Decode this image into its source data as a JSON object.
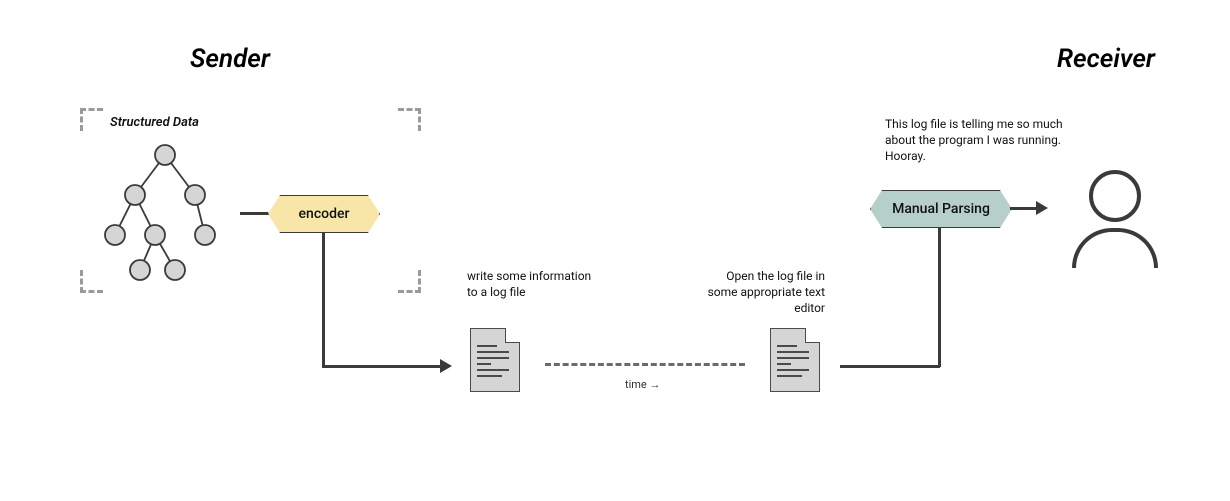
{
  "headings": {
    "sender": "Sender",
    "receiver": "Receiver"
  },
  "labels": {
    "structured_data": "Structured Data",
    "encoder": "encoder",
    "manual_parsing": "Manual Parsing"
  },
  "captions": {
    "write_log": "write some information to a log file",
    "open_log": "Open the log file in some appropriate text editor",
    "time": "time →"
  },
  "speech": {
    "receiver": "This log file is telling me so much about the program I was running. Hooray."
  }
}
